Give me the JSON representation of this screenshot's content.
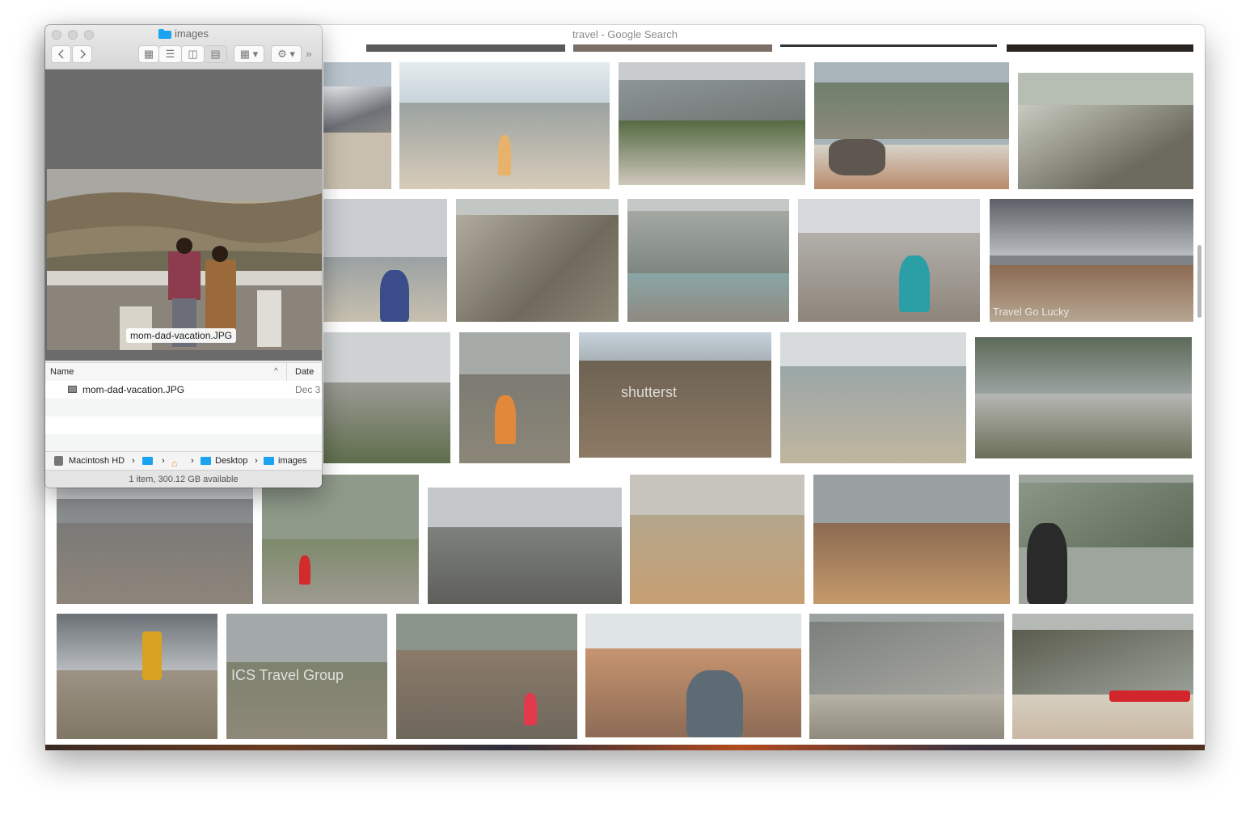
{
  "browser": {
    "title": "travel - Google Search"
  },
  "results": {
    "watermarks": {
      "travel_go_lucky": "Travel Go Lucky",
      "shutterstock": "shutterst",
      "ics": "ICS Travel Group"
    }
  },
  "finder": {
    "title": "images",
    "toolbar": {
      "back_icon": "chevron-left-icon",
      "forward_icon": "chevron-right-icon",
      "view_icon_label": "▦",
      "view_list_label": "☰",
      "view_column_label": "◫",
      "view_cover_label": "▤",
      "group_label": "▦ ▾",
      "action_label": "⚙ ▾",
      "overflow_label": "»"
    },
    "preview": {
      "filename": "mom-dad-vacation.JPG"
    },
    "list": {
      "col_name": "Name",
      "col_date": "Date M",
      "sort_indicator": "^",
      "rows": [
        {
          "name": "mom-dad-vacation.JPG",
          "date": "Dec 3"
        }
      ]
    },
    "pathbar": {
      "items": [
        "Macintosh HD",
        "",
        "",
        "Desktop",
        "images"
      ],
      "separator": "›"
    },
    "status": "1 item, 300.12 GB available"
  },
  "colors": {
    "finder_folder": "#1aa3f0",
    "preview_bg": "#6b6b6b"
  }
}
